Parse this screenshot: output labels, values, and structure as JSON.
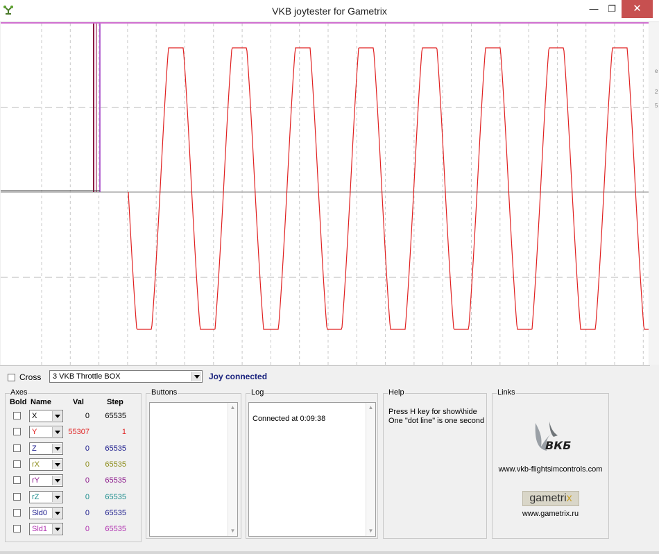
{
  "window": {
    "title": "VKB joytester for Gametrix",
    "min_glyph": "—",
    "max_glyph": "❐",
    "close_glyph": "✕",
    "icon": "joystick-app-icon"
  },
  "graph": {
    "trace_color": "#e02020",
    "marker_colors": [
      "#8b0040",
      "#9b30c0"
    ]
  },
  "right_strip": {
    "marks": [
      "e",
      "2",
      "5"
    ]
  },
  "controls": {
    "cross_label": "Cross",
    "device_selected": "3 VKB Throttle BOX",
    "status": "Joy connected"
  },
  "axes": {
    "group_label": "Axes",
    "headers": {
      "bold": "Bold",
      "name": "Name",
      "val": "Val",
      "step": "Step"
    },
    "rows": [
      {
        "name": "X",
        "val": "0",
        "step": "65535",
        "color": "#000000"
      },
      {
        "name": "Y",
        "val": "55307",
        "step": "1",
        "color": "#e02020"
      },
      {
        "name": "Z",
        "val": "0",
        "step": "65535",
        "color": "#1a1a8c"
      },
      {
        "name": "rX",
        "val": "0",
        "step": "65535",
        "color": "#8c8c1a"
      },
      {
        "name": "rY",
        "val": "0",
        "step": "65535",
        "color": "#8c1a8c"
      },
      {
        "name": "rZ",
        "val": "0",
        "step": "65535",
        "color": "#1a8c8c"
      },
      {
        "name": "Sld0",
        "val": "0",
        "step": "65535",
        "color": "#1a1a8c"
      },
      {
        "name": "Sld1",
        "val": "0",
        "step": "65535",
        "color": "#b030b0"
      }
    ]
  },
  "buttons": {
    "group_label": "Buttons"
  },
  "log": {
    "group_label": "Log",
    "lines": [
      "Connected at 0:09:38"
    ]
  },
  "help": {
    "group_label": "Help",
    "line1": "Press H key for show\\hide",
    "line2": "One \"dot line\" is one second"
  },
  "links": {
    "group_label": "Links",
    "vkb_logo_text": "ВКБ",
    "vkb_url": "www.vkb-flightsimcontrols.com",
    "gametrix_logo_a": "game",
    "gametrix_logo_b": "tri",
    "gametrix_logo_c": "x",
    "gametrix_url": "www.gametrix.ru"
  }
}
